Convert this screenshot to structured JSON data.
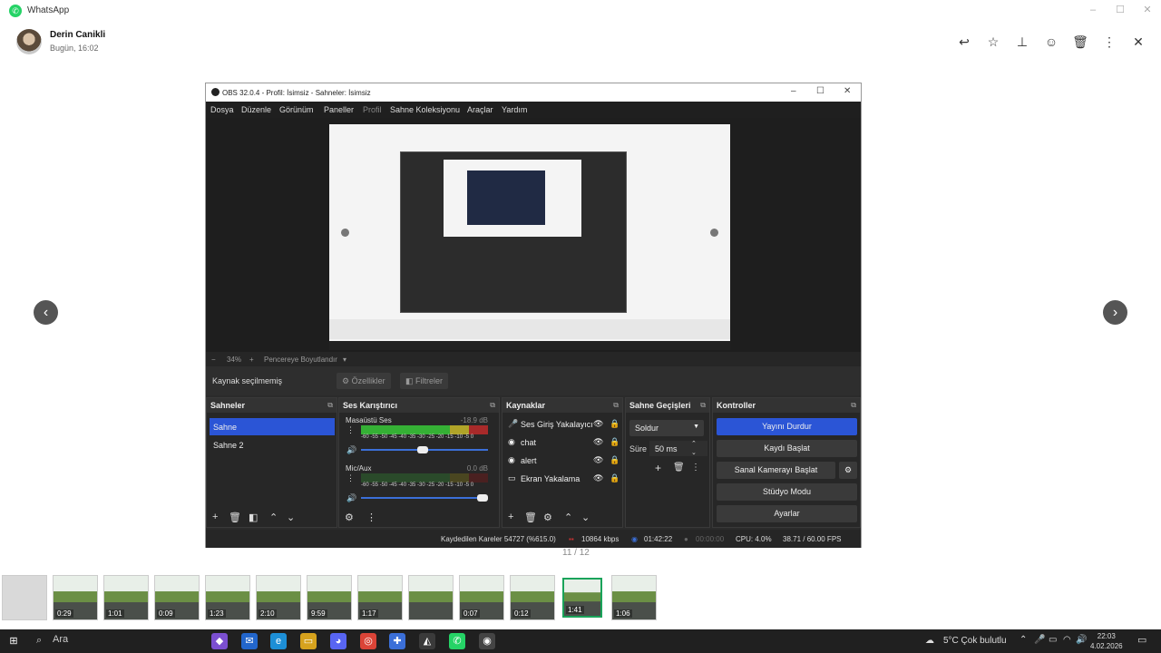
{
  "viewer": {
    "app_title": "WhatsApp",
    "sender_name": "Derin Canikli",
    "sender_time": "Bugün, 16:02",
    "counter": "11 / 12",
    "thumb_durations": [
      "",
      "0:29",
      "1:01",
      "0:09",
      "1:23",
      "2:10",
      "9:59",
      "1:17",
      "",
      "0:07",
      "0:12",
      "1:41",
      "1:06"
    ]
  },
  "obs": {
    "title": "OBS 32.0.4 - Profil: İsimsiz - Sahneler: İsimsiz",
    "menu": [
      "Dosya",
      "Düzenle",
      "Görünüm",
      "Paneller",
      "Profil",
      "Sahne Koleksiyonu",
      "Araçlar",
      "Yardım"
    ],
    "zoom": {
      "minus": "−",
      "value": "34%",
      "plus": "+",
      "fit": "Pencereye Boyutlandır"
    },
    "context": {
      "no_source": "Kaynak seçilmemiş",
      "properties": "Özellikler",
      "filters": "Filtreler"
    },
    "scenes": {
      "title": "Sahneler",
      "items": [
        "Sahne",
        "Sahne 2"
      ]
    },
    "mixer": {
      "title": "Ses Karıştırıcı",
      "ch1_name": "Masaüstü Ses",
      "ch1_db": "-18.9 dB",
      "ch2_name": "Mic/Aux",
      "ch2_db": "0.0 dB",
      "scale": "-60 -55 -50 -45 -40 -35 -30 -25 -20 -15 -10 -5 0"
    },
    "sources": {
      "title": "Kaynaklar",
      "items": [
        "Ses Giriş Yakalayıcı",
        "chat",
        "alert",
        "Ekran Yakalama"
      ]
    },
    "transitions": {
      "title": "Sahne Geçişleri",
      "type": "Soldur",
      "duration_label": "Süre",
      "duration_value": "50 ms"
    },
    "controls": {
      "title": "Kontroller",
      "stop_stream": "Yayını Durdur",
      "start_record": "Kaydı Başlat",
      "start_virtualcam": "Sanal Kamerayı Başlat",
      "studio_mode": "Stüdyo Modu",
      "settings": "Ayarlar"
    },
    "status": {
      "dropped_frames": "Kaydedilen Kareler 54727 (%615.0)",
      "bitrate": "10864 kbps",
      "stream_time": "01:42:22",
      "rec_time": "00:00:00",
      "cpu": "CPU: 4.0%",
      "fps": "38.71 / 60.00 FPS"
    }
  },
  "taskbar": {
    "search": "Ara",
    "weather": "5°C  Çok bulutlu",
    "time": "22:03",
    "date": "4.02.2026"
  },
  "colors": {
    "accent": "#2b55d6",
    "whatsapp_green": "#25d366"
  }
}
